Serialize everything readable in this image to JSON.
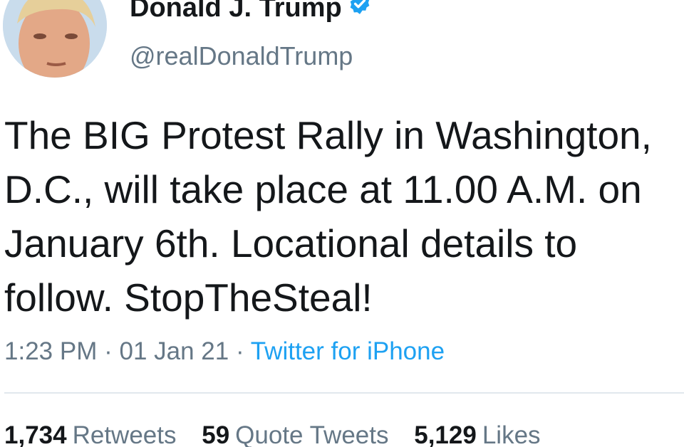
{
  "author": {
    "name": "Donald J. Trump",
    "handle": "@realDonaldTrump",
    "verified_icon": "verified-badge-icon",
    "avatar_icon": "profile-photo"
  },
  "tweet": {
    "text": "The BIG Protest Rally in Washington, D.C., will take place at 11.00 A.M. on January 6th. Locational details to follow. StopTheSteal!"
  },
  "meta": {
    "time": "1:23 PM",
    "separator": "·",
    "date": "01 Jan 21",
    "source": "Twitter for iPhone"
  },
  "stats": {
    "retweets": {
      "count": "1,734",
      "label": "Retweets"
    },
    "quote_tweets": {
      "count": "59",
      "label": "Quote Tweets"
    },
    "likes": {
      "count": "5,129",
      "label": "Likes"
    }
  },
  "colors": {
    "text": "#14171a",
    "secondary": "#657786",
    "link": "#1da1f2",
    "divider": "#e1e8ed"
  }
}
